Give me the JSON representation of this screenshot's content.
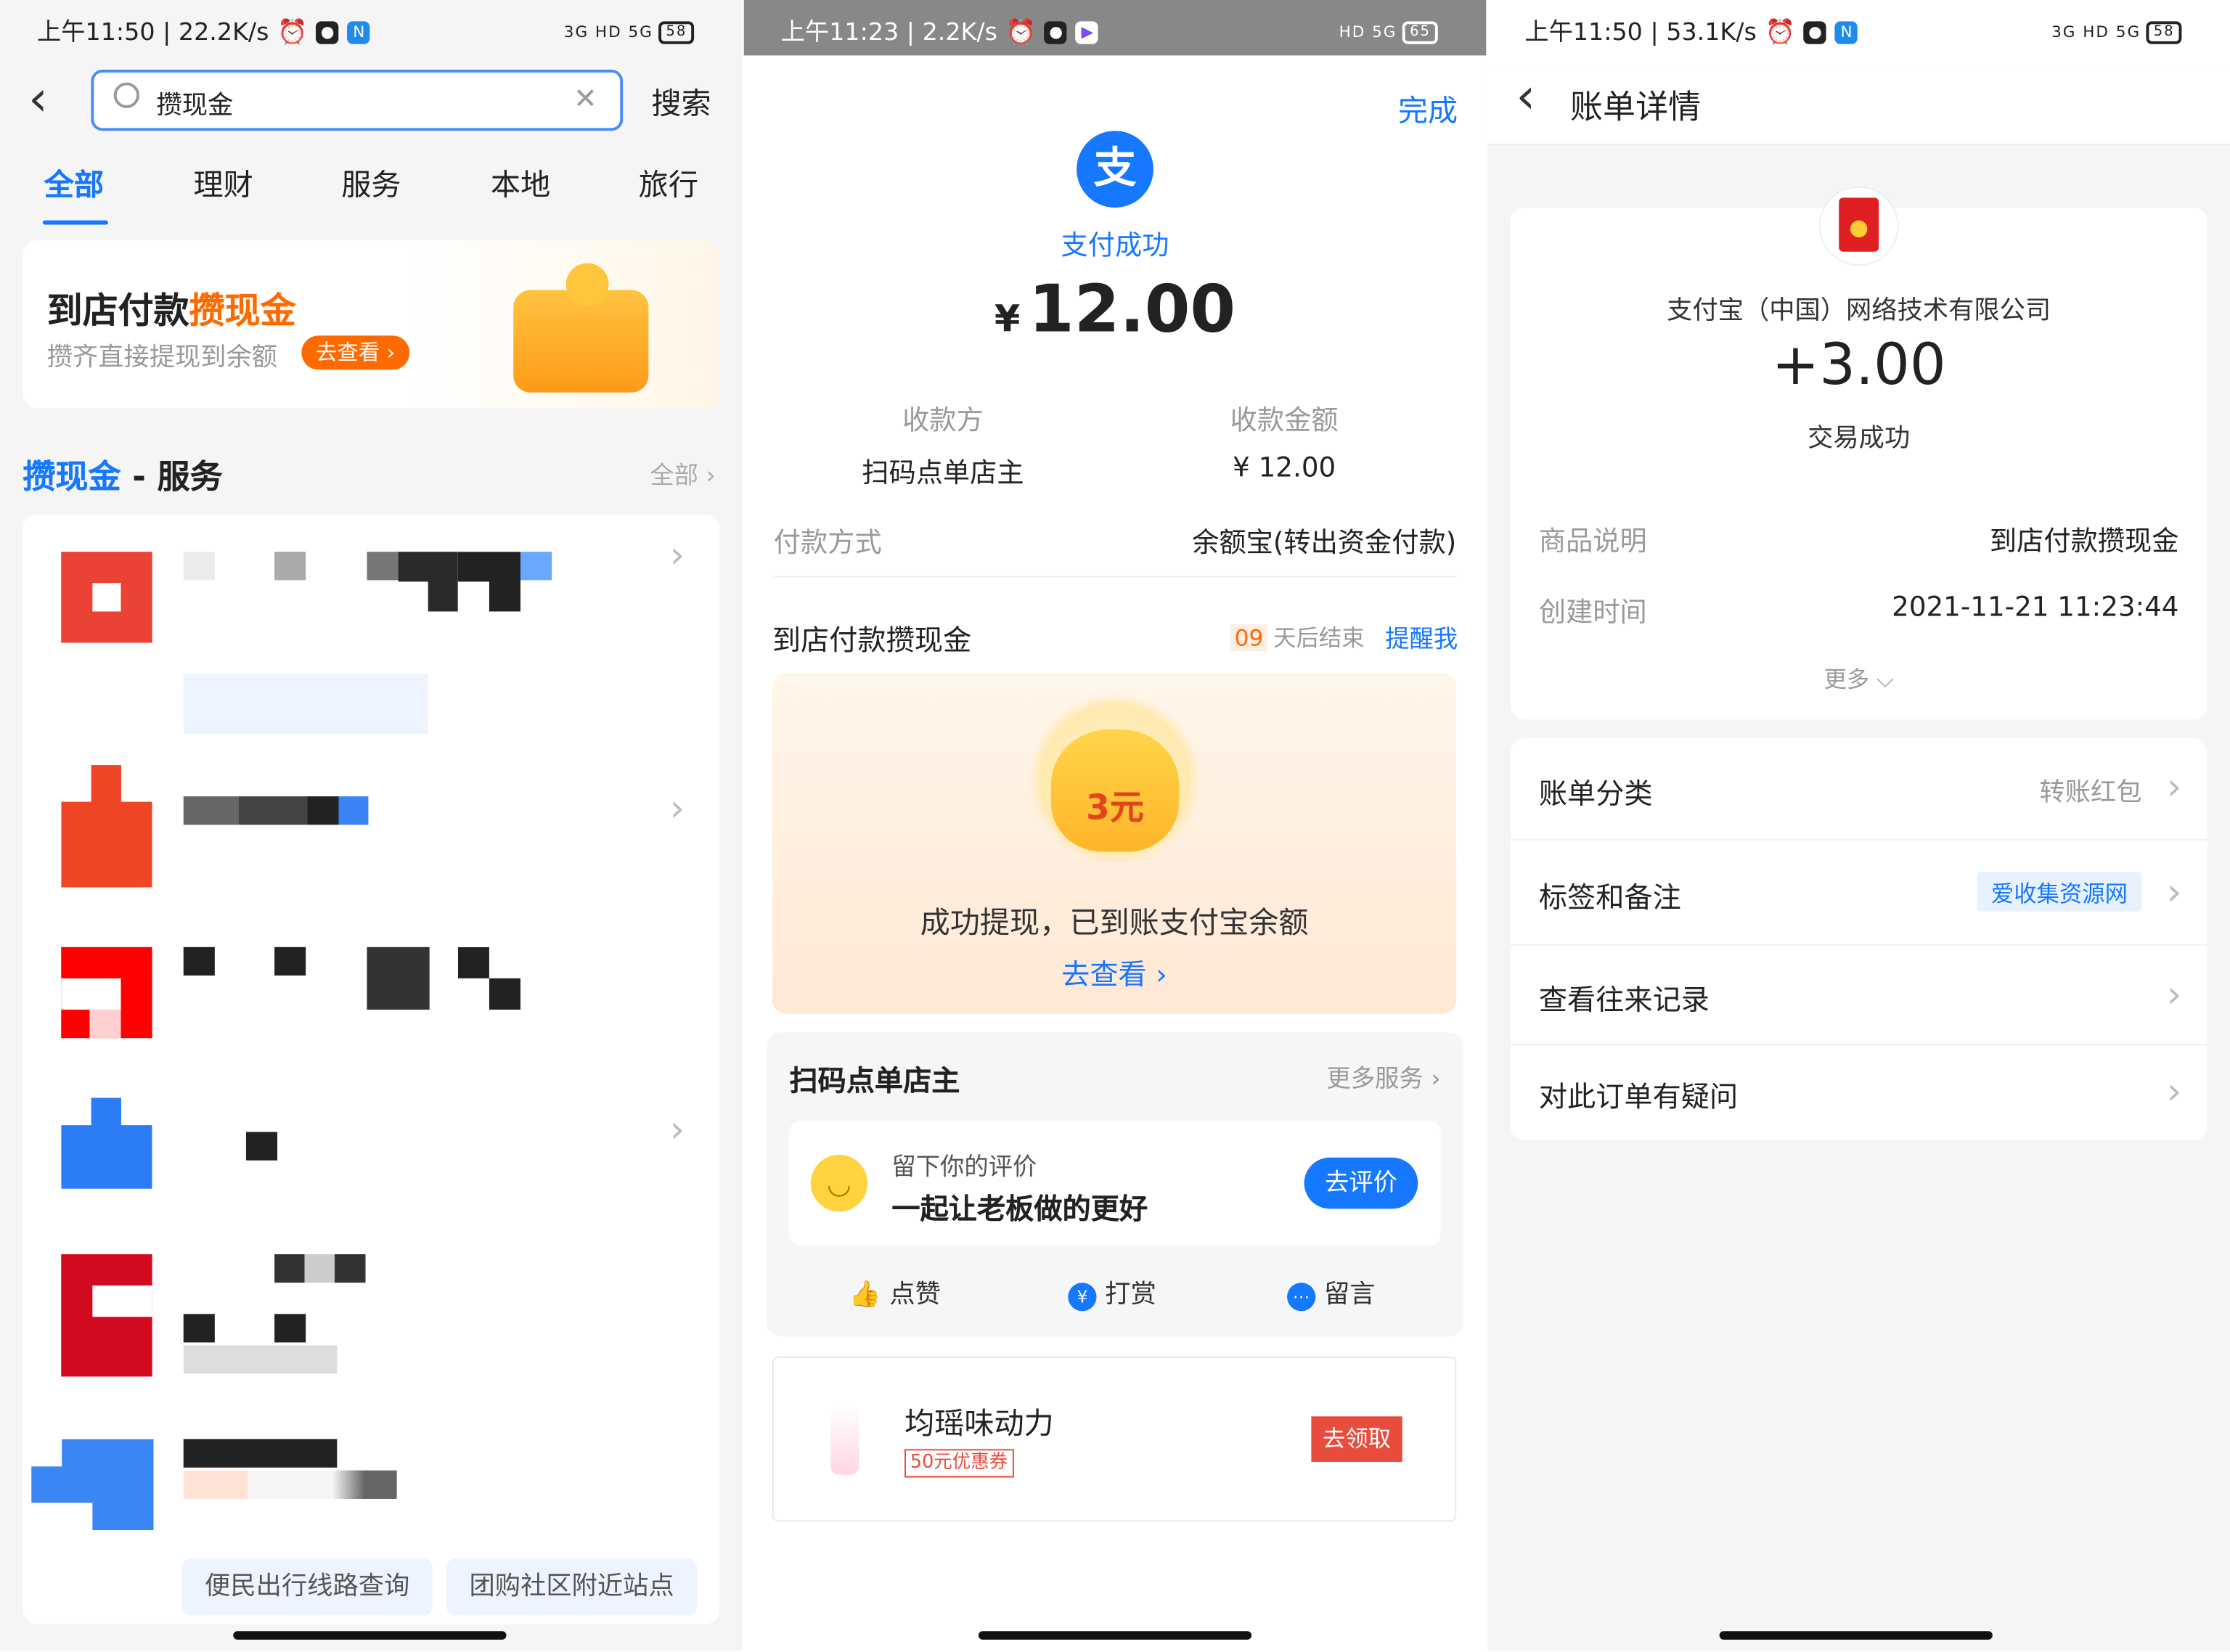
{
  "p1": {
    "status": {
      "left": "上午11:50 | 22.2K/s",
      "right": "3G HD 5G",
      "battery": "58"
    },
    "search": {
      "value": "攒现金",
      "submit": "搜索"
    },
    "tabs": [
      "全部",
      "理财",
      "服务",
      "本地",
      "旅行"
    ],
    "banner": {
      "title_a": "到店付款",
      "title_b": "攒现金",
      "sub": "攒齐直接提现到余额",
      "cta": "去查看 ›"
    },
    "section": {
      "title_a": "攒现金",
      "title_b": " - 服务",
      "all": "全部 ›"
    },
    "bottom_tags": [
      "便民出行线路查询",
      "团购社区附近站点"
    ]
  },
  "p2": {
    "status": {
      "left": "上午11:23 | 2.2K/s",
      "right": "HD 5G",
      "battery": "65"
    },
    "done": "完成",
    "pay_icon": "支",
    "pay_status": "支付成功",
    "amount": "12.00",
    "currency": "¥",
    "payee_label": "收款方",
    "payee_value": "扫码点单店主",
    "amt_label": "收款金额",
    "amt_value": "¥ 12.00",
    "method_label": "付款方式",
    "method_value": "余额宝(转出资金付款)",
    "promo": {
      "title": "到店付款攒现金",
      "days": "09",
      "days_suffix": "天后结束",
      "remind": "提醒我",
      "bag": "3元",
      "msg": "成功提现，已到账支付宝余额",
      "link": "去查看 ›"
    },
    "shop": {
      "name": "扫码点单店主",
      "more": "更多服务 ›",
      "review_t1": "留下你的评价",
      "review_t2": "一起让老板做的更好",
      "review_btn": "去评价",
      "actions": [
        "点赞",
        "打赏",
        "留言"
      ]
    },
    "ad": {
      "name": "均瑶味动力",
      "coupon": "50元优惠券",
      "cta": "去领取"
    }
  },
  "p3": {
    "status": {
      "left": "上午11:50 | 53.1K/s",
      "right": "3G HD 5G",
      "battery": "58"
    },
    "title": "账单详情",
    "company": "支付宝（中国）网络技术有限公司",
    "amount": "+3.00",
    "state": "交易成功",
    "rows": [
      {
        "label": "商品说明",
        "value": "到店付款攒现金"
      },
      {
        "label": "创建时间",
        "value": "2021-11-21 11:23:44"
      }
    ],
    "more": "更多 ⌵",
    "menu": [
      {
        "label": "账单分类",
        "value": "转账红包"
      },
      {
        "label": "标签和备注",
        "tag": "爱收集资源网"
      },
      {
        "label": "查看往来记录"
      },
      {
        "label": "对此订单有疑问"
      }
    ]
  },
  "colors": {
    "blue": "#1677ff",
    "orange": "#ff6a00",
    "red": "#e84c3d"
  }
}
